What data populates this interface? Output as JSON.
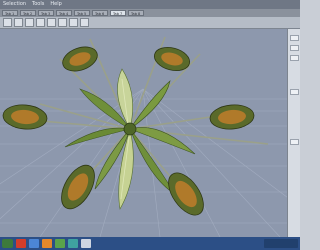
{
  "menu": [
    "Selection",
    "Tools",
    "Help"
  ],
  "tabs": [
    {
      "label": "Tab 1",
      "active": false
    },
    {
      "label": "Tab 2",
      "active": false
    },
    {
      "label": "Tab 3",
      "active": false
    },
    {
      "label": "Tab 4",
      "active": false
    },
    {
      "label": "Tab 5",
      "active": false
    },
    {
      "label": "Tab 6",
      "active": false
    },
    {
      "label": "Tab 7",
      "active": true
    },
    {
      "label": "Tab 8",
      "active": false
    }
  ],
  "colors": {
    "viewport_bg": "#8d98ad",
    "grid_line": "#a2acc0",
    "leaf_green": "#6f8f3a",
    "leaf_light": "#c8d49a",
    "pod_shell": "#5a6a2a",
    "pod_inner": "#b07a2a",
    "stem": "#9aa08a"
  },
  "icons": [
    "start-button-icon",
    "browser-icon",
    "folder-icon",
    "media-icon",
    "app-icon",
    "app-icon-2",
    "app-icon-3"
  ]
}
